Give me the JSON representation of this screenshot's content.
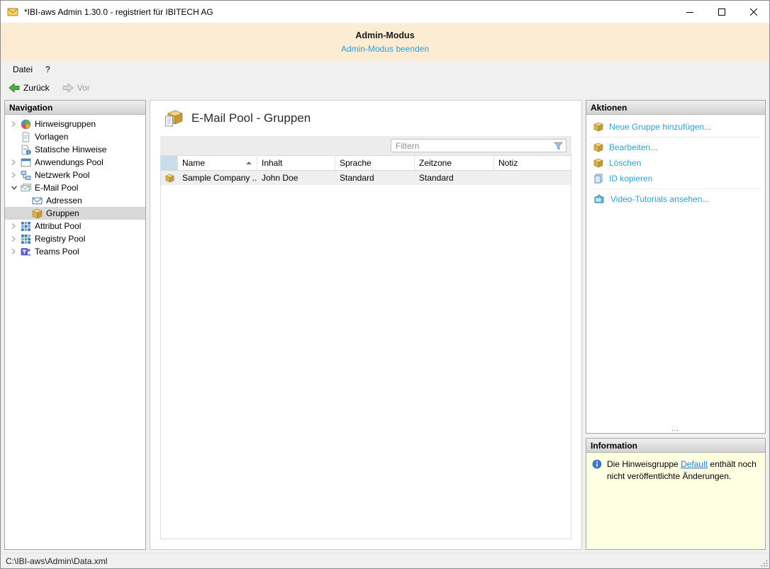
{
  "window": {
    "title": "*IBI-aws Admin 1.30.0 - registriert für IBITECH AG"
  },
  "banner": {
    "title": "Admin-Modus",
    "link": "Admin-Modus beenden"
  },
  "menu": {
    "items": [
      {
        "label": "Datei"
      },
      {
        "label": "?"
      }
    ]
  },
  "toolbar": {
    "back": "Zurück",
    "forward": "Vor"
  },
  "navigation": {
    "header": "Navigation",
    "items": [
      {
        "label": "Hinweisgruppen",
        "icon": "globe-icon",
        "expander": "collapsed",
        "level": 0,
        "selected": false
      },
      {
        "label": "Vorlagen",
        "icon": "template-icon",
        "expander": "none",
        "level": 0,
        "selected": false
      },
      {
        "label": "Statische Hinweise",
        "icon": "static-note-icon",
        "expander": "none",
        "level": 0,
        "selected": false
      },
      {
        "label": "Anwendungs Pool",
        "icon": "app-window-icon",
        "expander": "collapsed",
        "level": 0,
        "selected": false
      },
      {
        "label": "Netzwerk Pool",
        "icon": "network-icon",
        "expander": "collapsed",
        "level": 0,
        "selected": false
      },
      {
        "label": "E-Mail Pool",
        "icon": "mail-stack-icon",
        "expander": "expanded",
        "level": 0,
        "selected": false
      },
      {
        "label": "Adressen",
        "icon": "envelope-icon",
        "expander": "none",
        "level": 1,
        "selected": false
      },
      {
        "label": "Gruppen",
        "icon": "package-icon",
        "expander": "none",
        "level": 1,
        "selected": true
      },
      {
        "label": "Attribut Pool",
        "icon": "grid-icon",
        "expander": "collapsed",
        "level": 0,
        "selected": false
      },
      {
        "label": "Registry Pool",
        "icon": "registry-grid-icon",
        "expander": "collapsed",
        "level": 0,
        "selected": false
      },
      {
        "label": "Teams Pool",
        "icon": "teams-icon",
        "expander": "collapsed",
        "level": 0,
        "selected": false
      }
    ]
  },
  "main": {
    "title": "E-Mail Pool - Gruppen",
    "title_icon": "package-page-icon",
    "filter_placeholder": "Filtern",
    "table": {
      "columns": [
        "Name",
        "Inhalt",
        "Sprache",
        "Zeitzone",
        "Notiz"
      ],
      "sorted_column": "Name",
      "sort_direction": "asc",
      "rows": [
        {
          "icon": "package-icon",
          "name": "Sample Company ...",
          "inhalt": "John Doe",
          "sprache": "Standard",
          "zeitzone": "Standard",
          "notiz": ""
        }
      ]
    }
  },
  "actions": {
    "header": "Aktionen",
    "items": [
      {
        "label": "Neue Gruppe hinzufügen...",
        "icon": "package-icon"
      },
      {
        "label": "Bearbeiten...",
        "icon": "package-icon"
      },
      {
        "label": "Löschen",
        "icon": "package-icon"
      },
      {
        "label": "ID kopieren",
        "icon": "copy-icon"
      },
      {
        "label": "Video-Tutorials ansehen...",
        "icon": "tv-icon"
      }
    ],
    "overflow": "…"
  },
  "information": {
    "header": "Information",
    "icon": "info-icon",
    "text_before": "Die Hinweisgruppe ",
    "link": "Default",
    "text_after": " enthält noch nicht veröffentlichte Änderungen."
  },
  "statusbar": {
    "path": "C:\\IBI-aws\\Admin\\Data.xml"
  },
  "colors": {
    "banner_background": "#fbecd3",
    "link_blue": "#2f9fd6",
    "info_link_blue": "#2b7bd3",
    "info_background": "#ffffe1",
    "selection_gray": "#d8d8d8",
    "table_row_gray": "#efefef",
    "icon_col_blue": "#c9dcec"
  }
}
